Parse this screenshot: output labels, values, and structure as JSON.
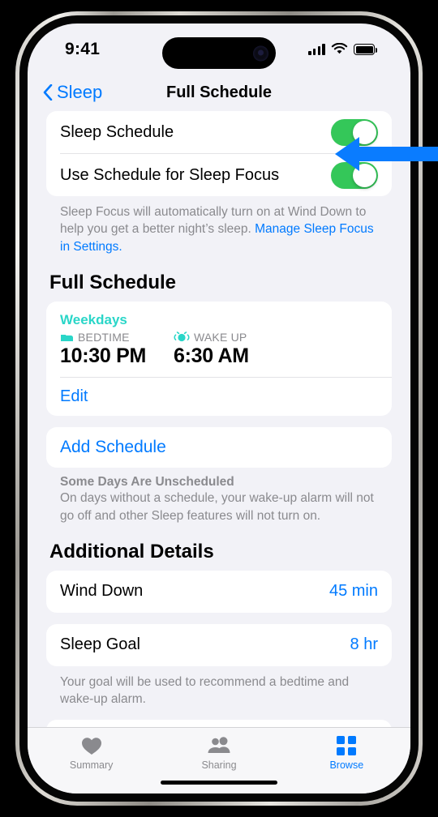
{
  "status_bar": {
    "time": "9:41",
    "signal_icon": "cellular-signal-icon",
    "wifi_icon": "wifi-icon",
    "battery_icon": "battery-icon"
  },
  "nav": {
    "back_label": "Sleep",
    "back_icon": "chevron-left-icon",
    "title": "Full Schedule"
  },
  "toggles": {
    "sleep_schedule": {
      "label": "Sleep Schedule",
      "value": "on"
    },
    "use_schedule_focus": {
      "label": "Use Schedule for Sleep Focus",
      "value": "on"
    }
  },
  "focus_footnote": {
    "text_before": "Sleep Focus will automatically turn on at Wind Down to help you get a better night’s sleep. ",
    "link_text": "Manage Sleep Focus in Settings."
  },
  "full_schedule": {
    "section_title": "Full Schedule",
    "days": "Weekdays",
    "bedtime": {
      "icon": "bed-icon",
      "label": "BEDTIME",
      "time": "10:30 PM"
    },
    "wakeup": {
      "icon": "alarm-clock-icon",
      "label": "WAKE UP",
      "time": "6:30 AM"
    },
    "edit_label": "Edit",
    "add_schedule_label": "Add Schedule",
    "note_title": "Some Days Are Unscheduled",
    "note_body": "On days without a schedule, your wake-up alarm will not go off and other Sleep features will not turn on."
  },
  "additional_details": {
    "section_title": "Additional Details",
    "wind_down": {
      "label": "Wind Down",
      "value": "45 min"
    },
    "sleep_goal": {
      "label": "Sleep Goal",
      "value": "8 hr"
    },
    "goal_footnote": "Your goal will be used to recommend a bedtime and wake-up alarm."
  },
  "tab_bar": {
    "tabs": [
      {
        "label": "Summary",
        "icon": "heart-icon",
        "active": false
      },
      {
        "label": "Sharing",
        "icon": "people-icon",
        "active": false
      },
      {
        "label": "Browse",
        "icon": "grid-icon",
        "active": true
      }
    ]
  },
  "annotation": {
    "icon": "left-arrow-annotation",
    "color": "#0A7CFF"
  },
  "colors": {
    "accent_blue": "#007AFF",
    "toggle_green": "#34C759",
    "schedule_teal": "#2AD6C8",
    "page_background": "#F2F2F7",
    "card_background": "#FFFFFF",
    "secondary_text": "#8A8A8E"
  }
}
